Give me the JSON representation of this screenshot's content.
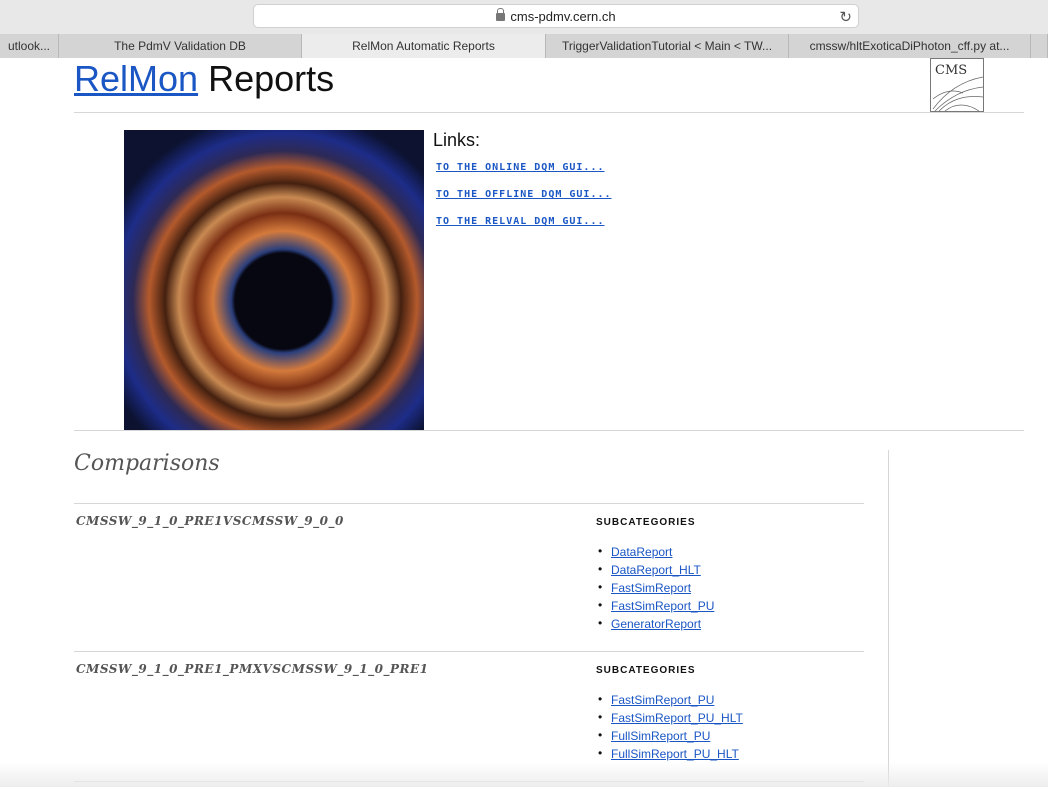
{
  "browser": {
    "url": "cms-pdmv.cern.ch",
    "tabs": [
      {
        "label": "utlook..."
      },
      {
        "label": "The PdmV Validation DB"
      },
      {
        "label": "RelMon Automatic Reports"
      },
      {
        "label": "TriggerValidationTutorial < Main < TW..."
      },
      {
        "label": "cmssw/hltExoticaDiPhoton_cff.py at..."
      }
    ]
  },
  "header": {
    "title_link": "RelMon",
    "title_rest": " Reports",
    "logo_text": "CMS"
  },
  "links": {
    "title": "Links:",
    "items": [
      {
        "label": "TO THE ONLINE DQM GUI..."
      },
      {
        "label": "TO THE OFFLINE DQM GUI..."
      },
      {
        "label": "TO THE RELVAL DQM GUI..."
      }
    ]
  },
  "comparisons": {
    "heading": "Comparisons",
    "items": [
      {
        "title": "CMSSW_9_1_0_PRE1VSCMSSW_9_0_0",
        "subcategories_label": "SUBCATEGORIES",
        "subcategories": [
          "DataReport",
          "DataReport_HLT",
          "FastSimReport",
          "FastSimReport_PU",
          "GeneratorReport"
        ]
      },
      {
        "title": "CMSSW_9_1_0_PRE1_PMXVSCMSSW_9_1_0_PRE1",
        "subcategories_label": "SUBCATEGORIES",
        "subcategories": [
          "FastSimReport_PU",
          "FastSimReport_PU_HLT",
          "FullSimReport_PU",
          "FullSimReport_PU_HLT"
        ]
      }
    ]
  }
}
